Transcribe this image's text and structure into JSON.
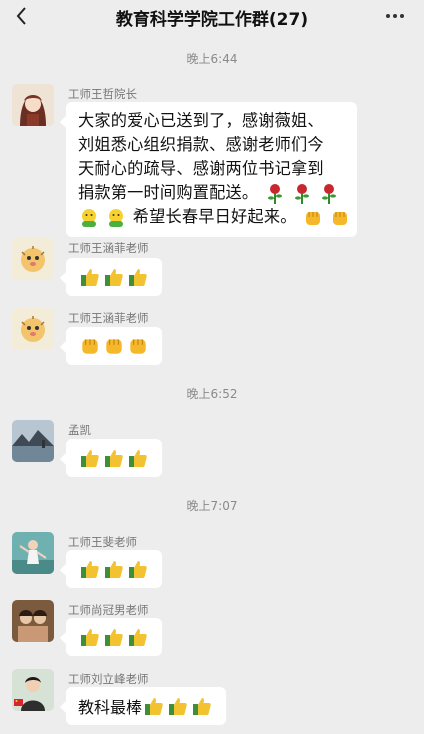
{
  "header": {
    "title": "教育科学学院工作群(27)",
    "back_icon": "chevron-left-icon",
    "more_icon": "more-dots-icon"
  },
  "timestamps": [
    "晚上6:44",
    "晚上6:52",
    "晚上7:07"
  ],
  "messages": [
    {
      "sender": "工师王哲院长",
      "lines": [
        "大家的爱心已送到了，感谢薇姐、",
        "刘姐悉心组织捐款、感谢老师们今",
        "天耐心的疏导、感谢两位书记拿到",
        "捐款第一时间购置配送。",
        "希望长春早日好起来。"
      ],
      "emoji": [
        "rose-emoji",
        "hug-emoji",
        "fist-emoji"
      ]
    },
    {
      "sender": "工师王涵菲老师",
      "emoji": "thumbs-up-emoji",
      "count": 3
    },
    {
      "sender": "工师王涵菲老师",
      "emoji": "fist-emoji",
      "count": 3
    },
    {
      "sender": "孟凯",
      "emoji": "thumbs-up-emoji",
      "count": 3
    },
    {
      "sender": "工师王斐老师",
      "emoji": "thumbs-up-emoji",
      "count": 3
    },
    {
      "sender": "工师尚冠男老师",
      "emoji": "thumbs-up-emoji",
      "count": 3
    },
    {
      "sender": "工师刘立峰老师",
      "text": "教科最棒",
      "emoji": "thumbs-up-emoji",
      "count": 3
    }
  ],
  "colors": {
    "background": "#ededed",
    "bubble": "#ffffff",
    "meta_text": "#8a8a8a"
  }
}
